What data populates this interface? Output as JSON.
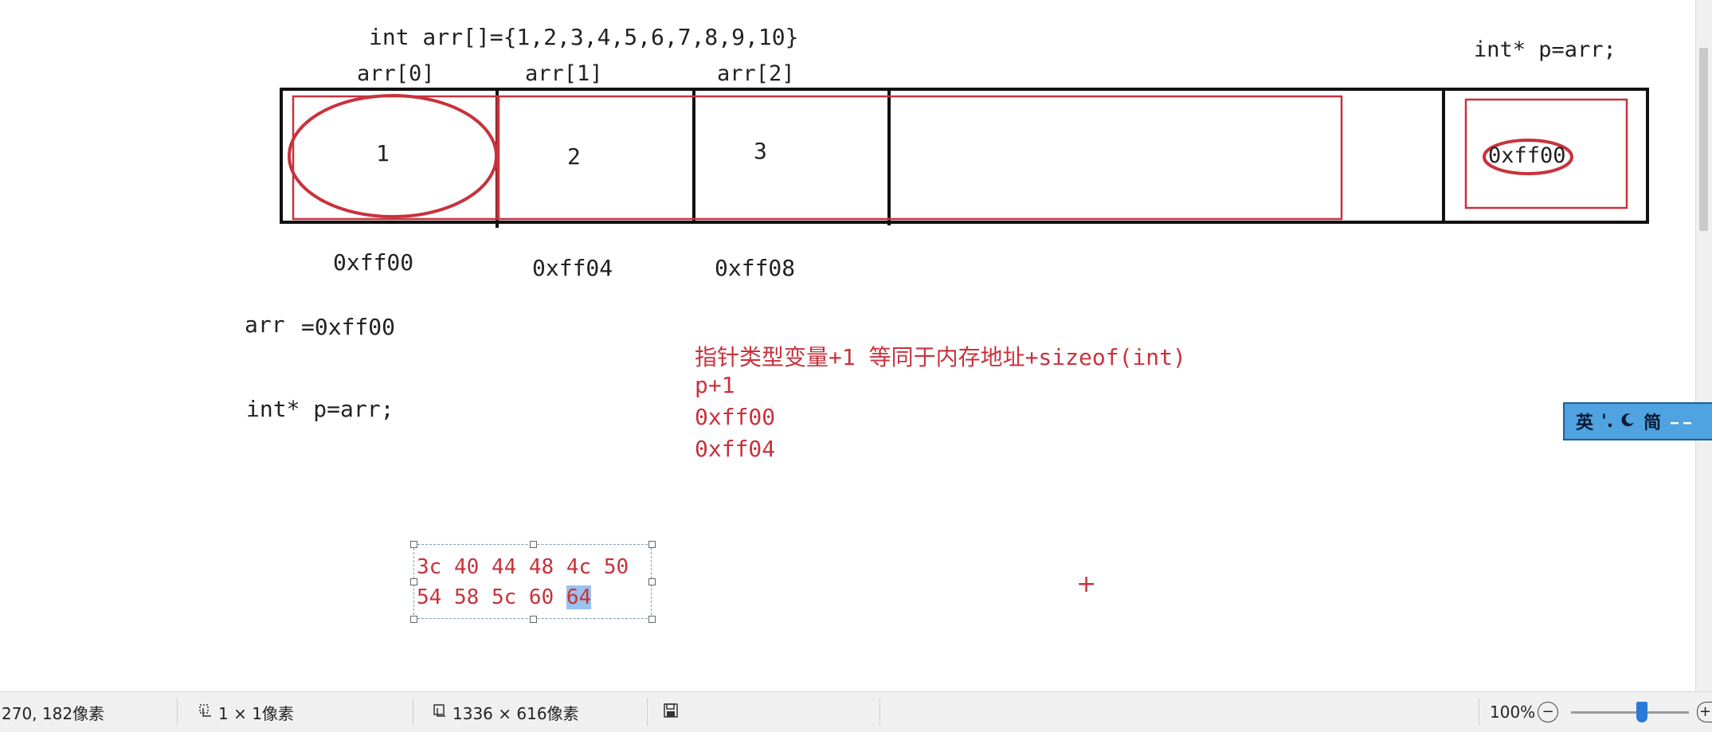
{
  "canvas": {
    "decl_array": "int arr[]={1,2,3,4,5,6,7,8,9,10}",
    "decl_pointer_top": "int* p=arr;",
    "index_labels": [
      "arr[0]",
      "arr[1]",
      "arr[2]"
    ],
    "cell_values": [
      "1",
      "2",
      "3"
    ],
    "pointer_value": "0xff00",
    "address_labels": [
      "0xff00",
      "0xff04",
      "0xff08"
    ],
    "arr_label": "arr",
    "arr_value": "=0xff00",
    "decl_pointer_left": "int* p=arr;",
    "notes": [
      "指针类型变量+1  等同于内存地址+sizeof(int)",
      "p+1",
      "0xff00",
      "0xff04"
    ],
    "hex_rows": [
      [
        "3c",
        "40",
        "44",
        "48",
        "4c",
        "50"
      ],
      [
        "54",
        "58",
        "5c",
        "60",
        "64"
      ]
    ],
    "hex_selected": "64",
    "crosshair": "+"
  },
  "ime_toolbar": {
    "lang": "英",
    "punct": "'.",
    "mode_icon": "moon-icon",
    "charset": "简"
  },
  "statusbar": {
    "cursor_pos": "270, 182像素",
    "selection_size": "1 × 1像素",
    "image_size": "1336 × 616像素",
    "zoom": "100%",
    "zoom_minus": "−",
    "zoom_plus": "+",
    "zoom_level": 0.6
  },
  "colors": {
    "annotation_red": "#c8323c",
    "selection_blue": "#99c2ee"
  }
}
